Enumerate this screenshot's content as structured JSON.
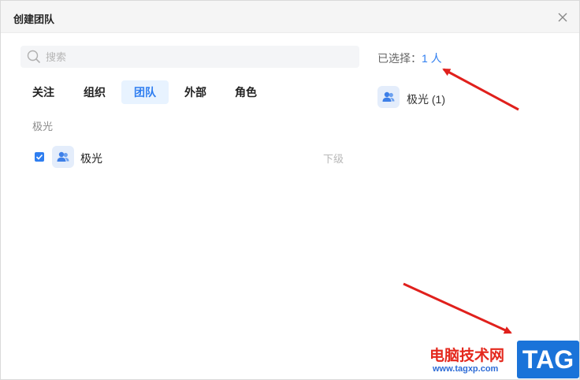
{
  "dialog": {
    "title": "创建团队"
  },
  "search": {
    "placeholder": "搜索"
  },
  "tabs": [
    {
      "label": "关注",
      "active": false
    },
    {
      "label": "组织",
      "active": false
    },
    {
      "label": "团队",
      "active": true
    },
    {
      "label": "外部",
      "active": false
    },
    {
      "label": "角色",
      "active": false
    }
  ],
  "list": {
    "group_label": "极光",
    "rows": [
      {
        "name": "极光",
        "checked": true,
        "sub_action": "下级",
        "icon": "team-icon"
      }
    ]
  },
  "selected": {
    "summary_prefix": "已选择：",
    "summary_count": "1 人",
    "items": [
      {
        "label": "极光 (1)",
        "icon": "team-icon"
      }
    ]
  },
  "watermark": {
    "text": "电脑技术网",
    "url": "www.tagxp.com",
    "badge": "TAG"
  },
  "colors": {
    "accent": "#2f7ef0",
    "tab_active_bg": "#e8f3ff",
    "annotation_arrow": "#e0201c"
  }
}
